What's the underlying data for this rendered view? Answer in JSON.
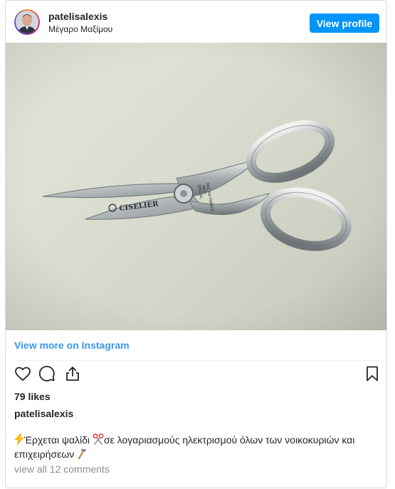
{
  "header": {
    "username": "patelisalexis",
    "location": "Μέγαρο Μαξίμου",
    "view_profile_label": "View profile"
  },
  "photo": {
    "brand": "CISELIER",
    "blade_stamp": [
      "FAIL AN FRANCE",
      "INOX",
      "SPECIAL"
    ]
  },
  "view_more_label": "View more on Instagram",
  "icons": {
    "like": "heart-icon",
    "comment": "comment-bubble-icon",
    "share": "share-icon",
    "save": "bookmark-icon"
  },
  "likes_text": "79 likes",
  "caption": {
    "username": "patelisalexis",
    "part1": "Έρχεται ψαλίδι ",
    "part2": "σε λογαριασμούς ηλεκτρισμού όλων των νοικοκυριών και επιχειρήσεων ",
    "emojis": [
      "lightning-emoji",
      "scissors-emoji",
      "hammer-emoji"
    ]
  },
  "comments_link": "view all 12 comments",
  "colors": {
    "accent": "#0095f6",
    "link": "#3897f0",
    "text": "#262626",
    "muted": "#8e8e8e",
    "border": "#dbdbdb"
  }
}
